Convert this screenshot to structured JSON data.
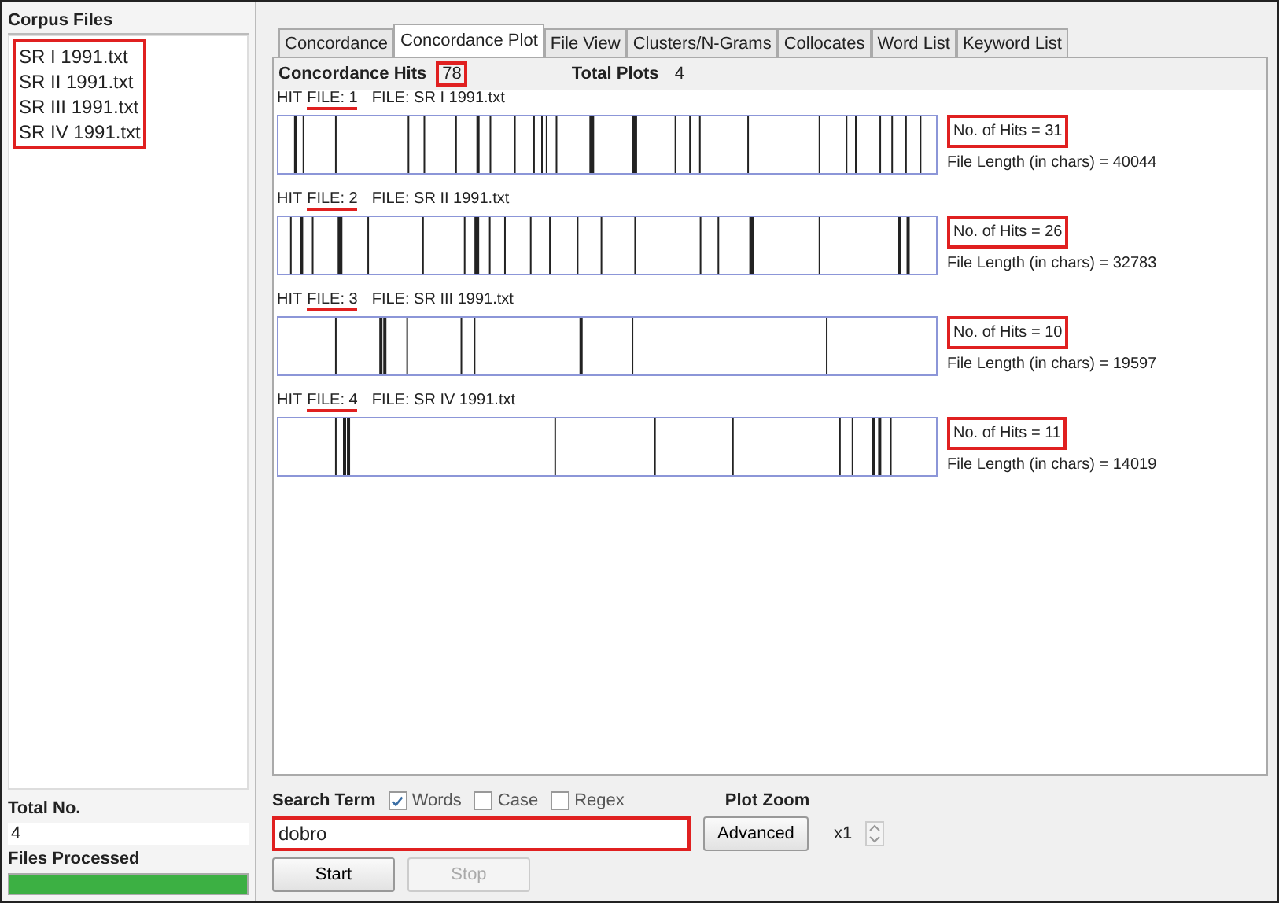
{
  "sidebar": {
    "title": "Corpus Files",
    "files_marked": true,
    "files": [
      {
        "name": "SR I 1991.txt",
        "selected": false
      },
      {
        "name": "SR II 1991.txt",
        "selected": false
      },
      {
        "name": "SR III 1991.txt",
        "selected": false
      },
      {
        "name": "SR IV 1991.txt",
        "selected": false
      }
    ],
    "total_label": "Total No.",
    "total_value": "4",
    "processed_label": "Files Processed",
    "progress": {
      "level": 1
    }
  },
  "tabs": [
    {
      "label": "Concordance",
      "selected": false
    },
    {
      "label": "Concordance Plot",
      "selected": true
    },
    {
      "label": "File View",
      "selected": false
    },
    {
      "label": "Clusters/N-Grams",
      "selected": false
    },
    {
      "label": "Collocates",
      "selected": false
    },
    {
      "label": "Word List",
      "selected": false
    },
    {
      "label": "Keyword List",
      "selected": false
    }
  ],
  "summary": {
    "hits_label": "Concordance Hits",
    "hits_value": "78",
    "hits_marked": true,
    "plots_label": "Total Plots",
    "plots_value": "4"
  },
  "plots": [
    {
      "hit_label": "HIT",
      "file_link": "FILE: 1",
      "file_name": "FILE: SR I 1991.txt",
      "hits": "No. of Hits = 31",
      "length": "File Length (in chars) = 40044",
      "marked": true
    },
    {
      "hit_label": "HIT",
      "file_link": "FILE: 2",
      "file_name": "FILE: SR II 1991.txt",
      "hits": "No. of Hits = 26",
      "length": "File Length (in chars) = 32783",
      "marked": true
    },
    {
      "hit_label": "HIT",
      "file_link": "FILE: 3",
      "file_name": "FILE: SR III 1991.txt",
      "hits": "No. of Hits = 10",
      "length": "File Length (in chars) = 19597",
      "marked": true
    },
    {
      "hit_label": "HIT",
      "file_link": "FILE: 4",
      "file_name": "FILE: SR IV 1991.txt",
      "hits": "No. of Hits = 11",
      "length": "File Length (in chars) = 14019",
      "marked": true
    }
  ],
  "search": {
    "label": "Search Term",
    "options": [
      {
        "label": "Words",
        "checked": true
      },
      {
        "label": "Case",
        "checked": false
      },
      {
        "label": "Regex",
        "checked": false
      }
    ],
    "value": "dobro",
    "marked": true,
    "advanced": "Advanced",
    "start": "Start",
    "stop": "Stop",
    "stop_disabled": true
  },
  "zoom": {
    "label": "Plot Zoom",
    "value": "x1"
  }
}
